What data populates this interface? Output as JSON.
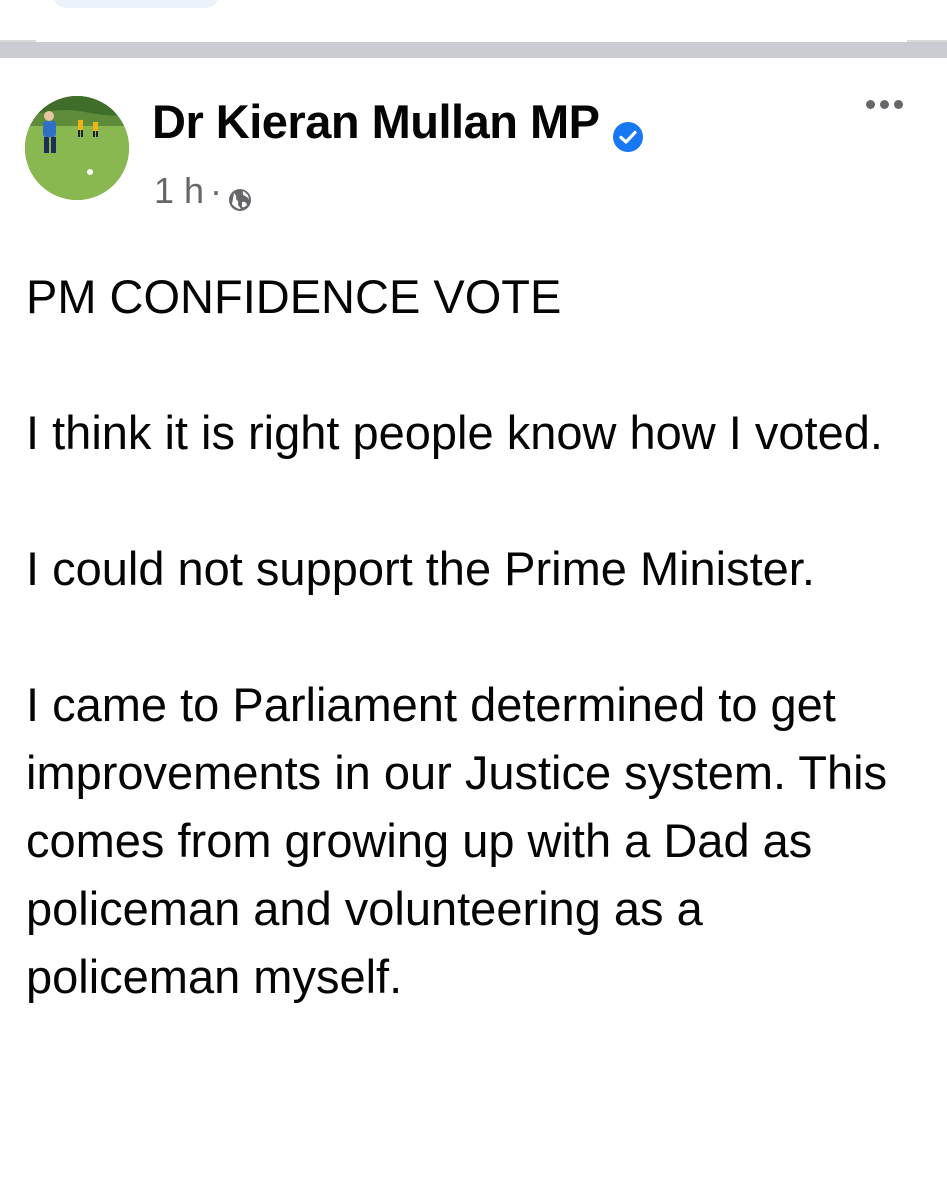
{
  "post": {
    "author": "Dr Kieran Mullan MP",
    "verified_icon": "verified-badge-icon",
    "time": "1 h",
    "separator": "·",
    "audience_icon": "globe-icon",
    "more_icon": "more-options-icon",
    "paragraphs": [
      "PM CONFIDENCE VOTE",
      "I think it is right people know how I voted.",
      "I could not support the Prime Minister.",
      "I came to Parliament determined to get improvements in our Justice system. This comes from growing up with a Dad as policeman and volunteering as a policeman myself."
    ]
  },
  "colors": {
    "verified": "#1877f2",
    "secondary_text": "#65676b",
    "separator": "#c9ccd1"
  }
}
